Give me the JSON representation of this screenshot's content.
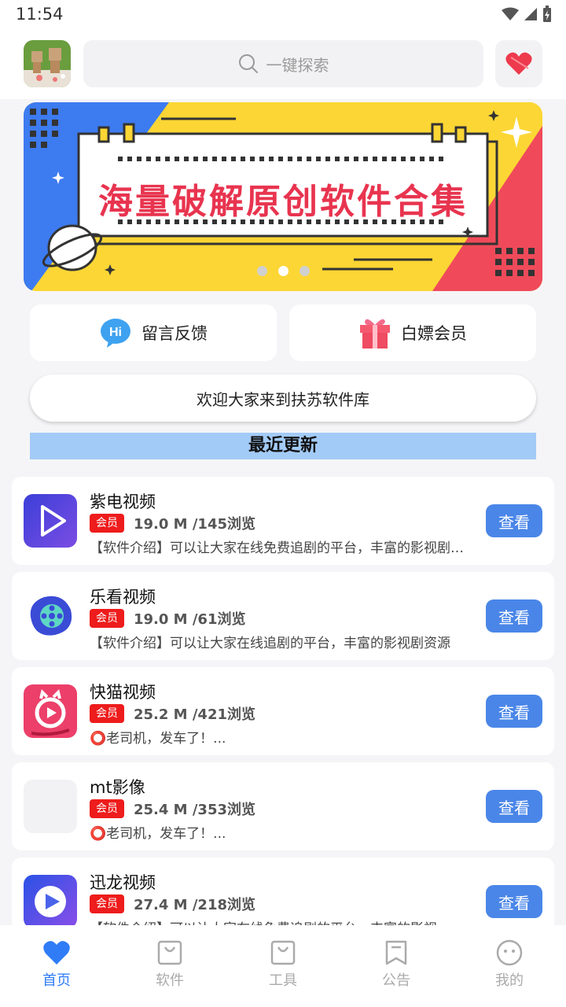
{
  "status": {
    "time": "11:54"
  },
  "search": {
    "placeholder": "一键探索"
  },
  "banner": {
    "title": "海量破解原创软件合集",
    "dot_count": 3,
    "active_dot": 1
  },
  "quick_actions": [
    {
      "label": "留言反馈",
      "icon": "hi-bubble-icon"
    },
    {
      "label": "白嫖会员",
      "icon": "gift-icon"
    }
  ],
  "welcome_text": "欢迎大家来到扶苏软件库",
  "section_title": "最近更新",
  "apps": [
    {
      "name": "紫电视频",
      "badge": "会员",
      "meta": "19.0 M /145浏览",
      "desc": "【软件介绍】可以让大家在线免费追剧的平台，丰富的影视剧资源",
      "button": "查看",
      "icon": "purple-play-icon"
    },
    {
      "name": "乐看视频",
      "badge": "会员",
      "meta": "19.0 M /61浏览",
      "desc": "【软件介绍】可以让大家在线追剧的平台，丰富的影视剧资源",
      "button": "查看",
      "icon": "film-reel-icon"
    },
    {
      "name": "快猫视频",
      "badge": "会员",
      "meta": "25.2 M /421浏览",
      "desc": "⭕老司机，发车了！...",
      "button": "查看",
      "icon": "cat-play-icon"
    },
    {
      "name": "mt影像",
      "badge": "会员",
      "meta": "25.4 M /353浏览",
      "desc": "⭕老司机，发车了！...",
      "button": "查看",
      "icon": "blank-icon"
    },
    {
      "name": "迅龙视频",
      "badge": "会员",
      "meta": "27.4 M /218浏览",
      "desc": "【软件介绍】可以让大家在线免费追剧的平台，丰富的影视",
      "button": "查看",
      "icon": "blue-play-icon"
    }
  ],
  "nav": [
    {
      "label": "首页",
      "icon": "heart-icon",
      "active": true
    },
    {
      "label": "软件",
      "icon": "bag-icon",
      "active": false
    },
    {
      "label": "工具",
      "icon": "bag-icon",
      "active": false
    },
    {
      "label": "公告",
      "icon": "bookmark-icon",
      "active": false
    },
    {
      "label": "我的",
      "icon": "smiley-icon",
      "active": false
    }
  ],
  "colors": {
    "accent": "#4a86e8",
    "badge": "#ee1c1c",
    "section_bg": "#a3cbf7",
    "nav_active": "#2f7cf6"
  }
}
